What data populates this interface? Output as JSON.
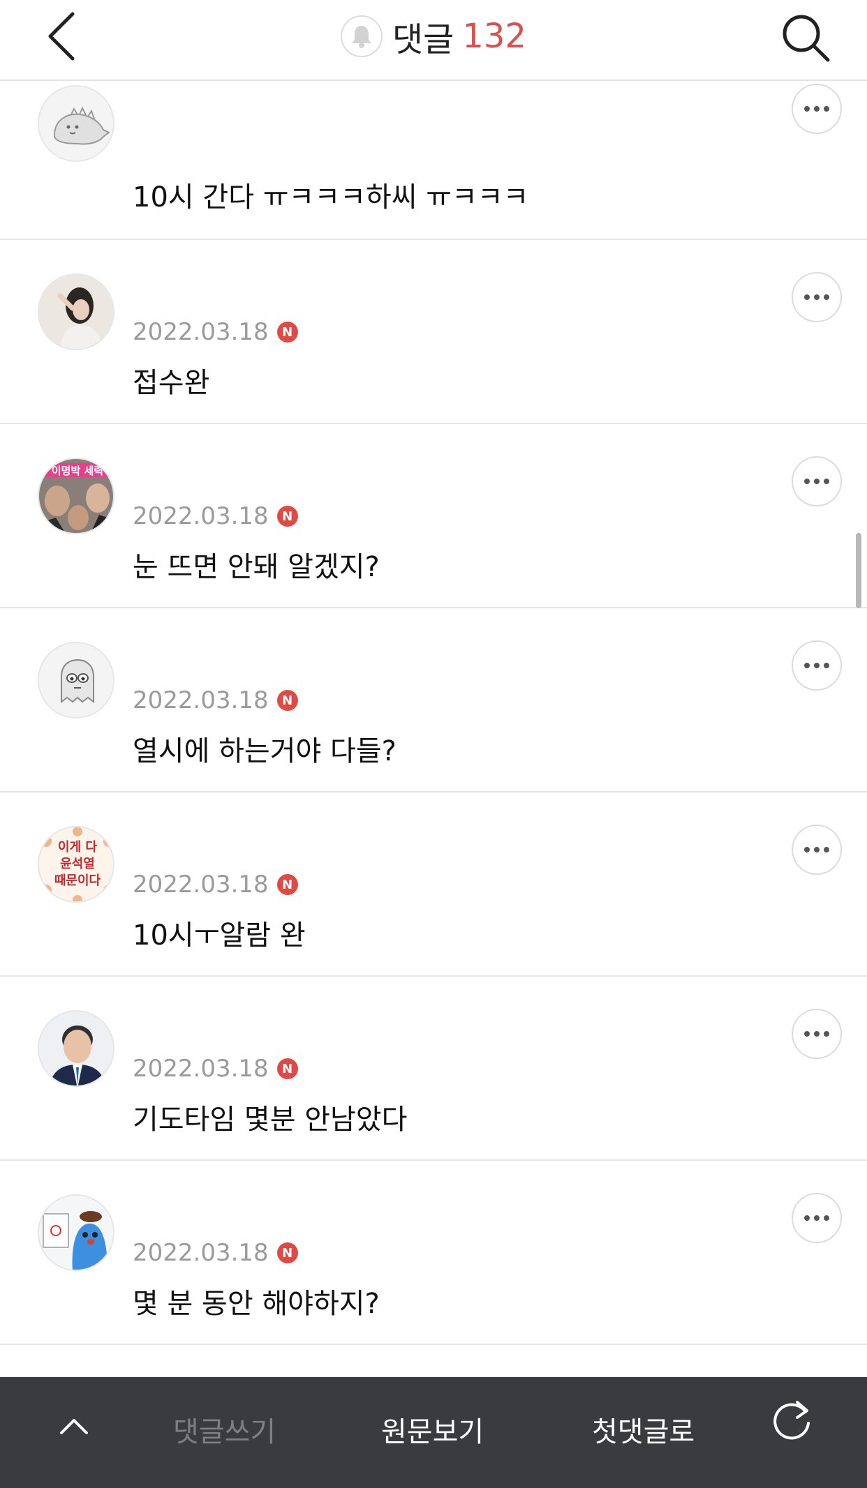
{
  "header": {
    "title": "댓글",
    "count": "132",
    "back_icon": "chevron-left-icon",
    "bell_icon": "bell-icon",
    "search_icon": "search-icon"
  },
  "comments": [
    {
      "name": "",
      "date": "",
      "badge": "",
      "text": "10시 간다 ㅠㅋㅋㅋ하씨 ㅠㅋㅋㅋ"
    },
    {
      "name": "",
      "date": "2022.03.18",
      "badge": "N",
      "text": "접수완"
    },
    {
      "name": "",
      "date": "2022.03.18",
      "badge": "N",
      "text": "눈 뜨면 안돼 알겠지?"
    },
    {
      "name": "",
      "date": "2022.03.18",
      "badge": "N",
      "text": "열시에 하는거야 다들?"
    },
    {
      "name": "",
      "date": "2022.03.18",
      "badge": "N",
      "text": "10시ㅜ알람 완"
    },
    {
      "name": "",
      "date": "2022.03.18",
      "badge": "N",
      "text": "기도타임 몇분 안남았다"
    },
    {
      "name": "",
      "date": "2022.03.18",
      "badge": "N",
      "text": "몇 분 동안 해야하지?"
    }
  ],
  "avatars": {
    "a3": {
      "line1": "이명박 세력"
    },
    "a5": {
      "line1": "이게 다",
      "line2": "윤석열",
      "line3": "때문이다"
    }
  },
  "bottom_bar": {
    "write": "댓글쓰기",
    "original": "원문보기",
    "first": "첫댓글로",
    "up_icon": "chevron-up-icon",
    "refresh_icon": "refresh-icon"
  },
  "colors": {
    "accent": "#d9514c",
    "badge": "#e14a44",
    "bottom_bar_bg": "#3a3b3f"
  }
}
